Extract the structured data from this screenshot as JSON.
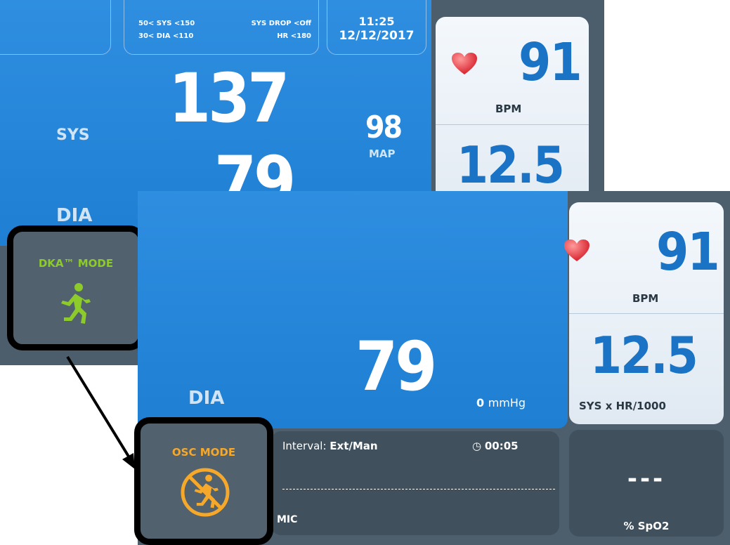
{
  "alarms": {
    "sys_limit": "50< SYS <150",
    "sys_drop": "SYS DROP <Off",
    "dia_limit": "30< DIA <110",
    "hr_limit": "HR <180"
  },
  "clock": {
    "time": "11:25",
    "date": "12/12/2017"
  },
  "bp": {
    "sys_label": "SYS",
    "dia_label": "DIA",
    "sys_value": "137",
    "dia_value": "79",
    "map_value": "98",
    "map_label": "MAP",
    "pressure": "0",
    "pressure_unit": "mmHg"
  },
  "hr": {
    "value": "91",
    "unit": "BPM",
    "index_value": "12.5",
    "index_label": "SYS x HR/1000",
    "icon": "heart-icon"
  },
  "interval": {
    "label": "Interval:",
    "value": "Ext/Man",
    "timer": "00:05",
    "source": "MIC"
  },
  "spo2": {
    "value": "---",
    "label": "% SpO2"
  },
  "modes": {
    "dka": {
      "label": "DKA™ MODE",
      "icon": "running-person-icon",
      "color": "#8ccb2a"
    },
    "osc": {
      "label": "OSC MODE",
      "icon": "no-running-icon",
      "color": "#f5a82a"
    }
  }
}
